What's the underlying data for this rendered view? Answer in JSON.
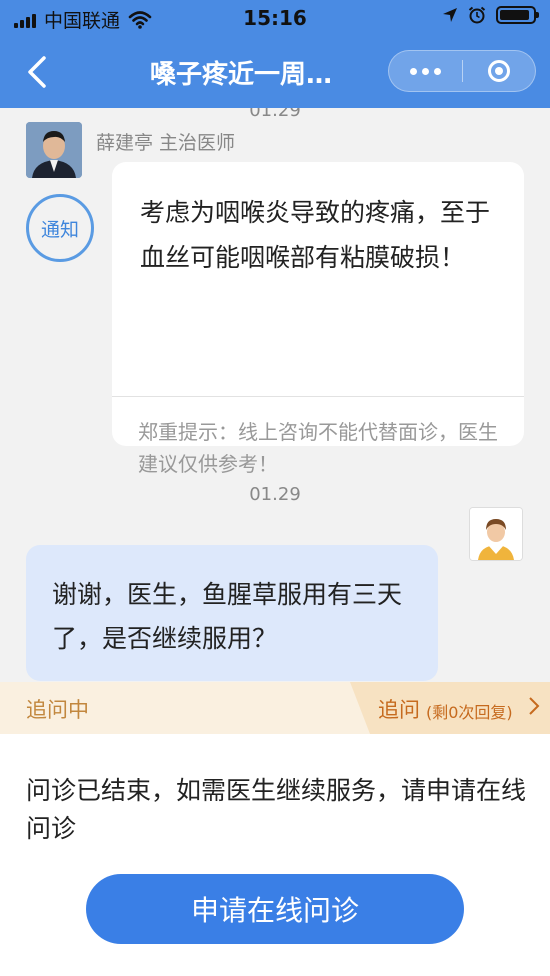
{
  "status_bar": {
    "carrier": "中国联通",
    "time": "15:16"
  },
  "nav": {
    "title": "嗓子疼近一周…"
  },
  "chat": {
    "top_date": "01.29",
    "doctor_name": "薛建亭  主治医师",
    "notice_label": "通知",
    "doctor_message": "考虑为咽喉炎导致的疼痛，至于血丝可能咽喉部有粘膜破损！",
    "doctor_tip": "郑重提示：线上咨询不能代替面诊，医生建议仅供参考！",
    "second_date": "01.29",
    "user_message": "谢谢，医生，鱼腥草服用有三天了，是否继续服用？"
  },
  "follow_up": {
    "state": "追问中",
    "action": "追问",
    "remaining": "(剩0次回复)"
  },
  "bottom": {
    "message": "问诊已结束，如需医生继续服务，请申请在线问诊",
    "button": "申请在线问诊"
  },
  "colors": {
    "brand_blue": "#4a8be3",
    "button_blue": "#3a7fe6",
    "user_bubble": "#dde8fb",
    "follow_bar": "#faf0e0",
    "follow_accent": "#c66a1e"
  }
}
